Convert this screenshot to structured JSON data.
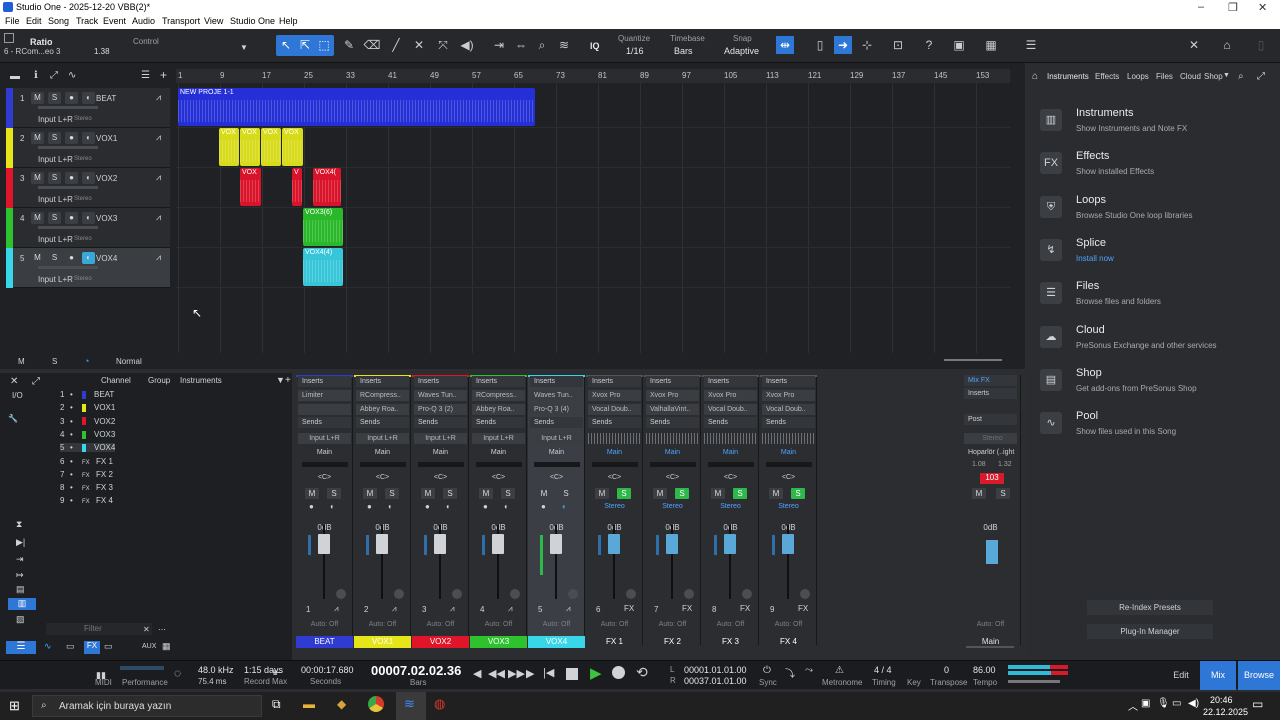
{
  "window": {
    "title": "Studio One - 2025-12-20 VBB(2)*"
  },
  "menu": [
    "File",
    "Edit",
    "Song",
    "Track",
    "Event",
    "Audio",
    "Transport",
    "View",
    "Studio One",
    "Help"
  ],
  "toolbar": {
    "insert_name": "Ratio",
    "insert_sub": "6 - RCom...eo 3",
    "insert_value": "1.38",
    "control_label": "Control",
    "quantize_label": "Quantize",
    "quantize_value": "1/16",
    "timebase_label": "Timebase",
    "timebase_value": "Bars",
    "snap_label": "Snap",
    "snap_value": "Adaptive",
    "iq_label": "IQ"
  },
  "ruler": [
    "1",
    "9",
    "17",
    "25",
    "33",
    "41",
    "49",
    "57",
    "65",
    "73",
    "81",
    "89",
    "97",
    "105",
    "113",
    "121",
    "129",
    "137",
    "145",
    "153"
  ],
  "tracks": [
    {
      "num": "1",
      "name": "BEAT",
      "color": "#2f3bd1",
      "input": "Input L+R",
      "mode": "Stereo"
    },
    {
      "num": "2",
      "name": "VOX1",
      "color": "#e5e51a",
      "input": "Input L+R",
      "mode": "Stereo"
    },
    {
      "num": "3",
      "name": "VOX2",
      "color": "#e0152a",
      "input": "Input L+R",
      "mode": "Stereo"
    },
    {
      "num": "4",
      "name": "VOX3",
      "color": "#2ec22e",
      "input": "Input L+R",
      "mode": "Stereo"
    },
    {
      "num": "5",
      "name": "VOX4",
      "color": "#38d6e8",
      "input": "Input L+R",
      "mode": "Stereo"
    }
  ],
  "clips": {
    "beat": "NEW PROJE 1-1",
    "vox1": [
      "VOX",
      "VOX",
      "VOX",
      "VOX"
    ],
    "vox2": [
      "VOX",
      "V",
      "VOX4("
    ],
    "vox3": "VOX3(6)",
    "vox4": "VOX4(4)"
  },
  "footer": {
    "m": "M",
    "s": "S",
    "mode": "Normal"
  },
  "channel_list": {
    "header_channel": "Channel",
    "header_group": "Group",
    "header_instruments": "Instruments",
    "io": "I/O",
    "rows": [
      {
        "num": "1",
        "name": "BEAT"
      },
      {
        "num": "2",
        "name": "VOX1"
      },
      {
        "num": "3",
        "name": "VOX2"
      },
      {
        "num": "4",
        "name": "VOX3"
      },
      {
        "num": "5",
        "name": "VOX4"
      },
      {
        "num": "6",
        "name": "FX 1"
      },
      {
        "num": "7",
        "name": "FX 2"
      },
      {
        "num": "8",
        "name": "FX 3"
      },
      {
        "num": "9",
        "name": "FX 4"
      }
    ],
    "filter_placeholder": "Filter",
    "aux": "AUX"
  },
  "strips": [
    {
      "name": "BEAT",
      "idx": "1",
      "color": "#2f3bd1",
      "ins": [
        "Limiter",
        ""
      ],
      "io": "Input L+R",
      "out": "Main",
      "pan": "<C>",
      "db": "0dB",
      "auto": "Auto: Off"
    },
    {
      "name": "VOX1",
      "idx": "2",
      "color": "#e5e51a",
      "ins": [
        "RCompress..",
        "Abbey Roa.."
      ],
      "io": "Input L+R",
      "out": "Main",
      "pan": "<C>",
      "db": "0dB",
      "auto": "Auto: Off"
    },
    {
      "name": "VOX2",
      "idx": "3",
      "color": "#e0152a",
      "ins": [
        "Waves Tun..",
        "Pro-Q 3 (2)"
      ],
      "io": "Input L+R",
      "out": "Main",
      "pan": "<C>",
      "db": "0dB",
      "auto": "Auto: Off"
    },
    {
      "name": "VOX3",
      "idx": "4",
      "color": "#2ec22e",
      "ins": [
        "RCompress..",
        "Abbey Roa.."
      ],
      "io": "Input L+R",
      "out": "Main",
      "pan": "<C>",
      "db": "0dB",
      "auto": "Auto: Off"
    },
    {
      "name": "VOX4",
      "idx": "5",
      "color": "#38d6e8",
      "ins": [
        "Waves Tun..",
        "Pro-Q 3 (4)"
      ],
      "io": "Input L+R",
      "out": "Main",
      "pan": "<C>",
      "db": "0dB",
      "auto": "Auto: Off"
    },
    {
      "name": "FX 1",
      "idx": "6",
      "color": "",
      "ins": [
        "Xvox Pro",
        "Vocal Doub.."
      ],
      "io": "",
      "out": "Main",
      "pan": "<C>",
      "db": "0dB",
      "auto": "Auto: Off",
      "stereo": "Stereo"
    },
    {
      "name": "FX 2",
      "idx": "7",
      "color": "",
      "ins": [
        "Xvox Pro",
        "ValhallaVint.."
      ],
      "io": "",
      "out": "Main",
      "pan": "<C>",
      "db": "0dB",
      "auto": "Auto: Off",
      "stereo": "Stereo"
    },
    {
      "name": "FX 3",
      "idx": "8",
      "color": "",
      "ins": [
        "Xvox Pro",
        "Vocal Doub.."
      ],
      "io": "",
      "out": "Main",
      "pan": "<C>",
      "db": "0dB",
      "auto": "Auto: Off",
      "stereo": "Stereo"
    },
    {
      "name": "FX 4",
      "idx": "9",
      "color": "",
      "ins": [
        "Xvox Pro",
        "Vocal Doub.."
      ],
      "io": "",
      "out": "Main",
      "pan": "<C>",
      "db": "0dB",
      "auto": "Auto: Off",
      "stereo": "Stereo"
    }
  ],
  "strip_labels": {
    "inserts": "Inserts",
    "sends": "Sends",
    "m": "M",
    "s": "S"
  },
  "main_strip": {
    "mixfx": "Mix FX",
    "inserts": "Inserts",
    "post": "Post",
    "stereo": "Stereo",
    "out": "Hoparlör (..ight",
    "v1": "1.08",
    "v2": "1.32",
    "peak": "103",
    "db": "0dB",
    "auto": "Auto: Off",
    "name": "Main"
  },
  "browser": {
    "tabs": [
      "Instruments",
      "Effects",
      "Loops",
      "Files",
      "Cloud",
      "Shop"
    ],
    "items": [
      {
        "title": "Instruments",
        "sub": "Show Instruments and Note FX",
        "icon": "piano"
      },
      {
        "title": "Effects",
        "sub": "Show installed Effects",
        "icon": "FX"
      },
      {
        "title": "Loops",
        "sub": "Browse Studio One loop libraries",
        "icon": "shield"
      },
      {
        "title": "Splice",
        "sub": "Install now",
        "icon": "splice"
      },
      {
        "title": "Files",
        "sub": "Browse files and folders",
        "icon": "list"
      },
      {
        "title": "Cloud",
        "sub": "PreSonus Exchange and other services",
        "icon": "cloud"
      },
      {
        "title": "Shop",
        "sub": "Get add-ons from PreSonus Shop",
        "icon": "shop"
      },
      {
        "title": "Pool",
        "sub": "Show files used in this Song",
        "icon": "pool"
      }
    ],
    "reindex": "Re-Index Presets",
    "plugin_manager": "Plug-In Manager"
  },
  "transport": {
    "midi": "MIDI",
    "performance": "Performance",
    "rate": "48.0 kHz",
    "latency": "75.4 ms",
    "record_days": "1:15 days",
    "record_label": "Record Max",
    "seconds": "00:00:17.680",
    "seconds_label": "Seconds",
    "bars": "00007.02.02.36",
    "bars_label": "Bars",
    "loop_l": "00001.01.01.00",
    "loop_r": "00037.01.01.00",
    "sync": "Sync",
    "metronome": "Metronome",
    "timing": "4 / 4",
    "timing_label": "Timing",
    "key_label": "Key",
    "transpose": "0",
    "transpose_label": "Transpose",
    "tempo": "86.00",
    "tempo_label": "Tempo",
    "l": "L",
    "r": "R",
    "edit": "Edit",
    "mix": "Mix",
    "browse": "Browse"
  },
  "taskbar": {
    "search": "Aramak için buraya yazın",
    "time": "20:46",
    "date": "22.12.2025"
  }
}
